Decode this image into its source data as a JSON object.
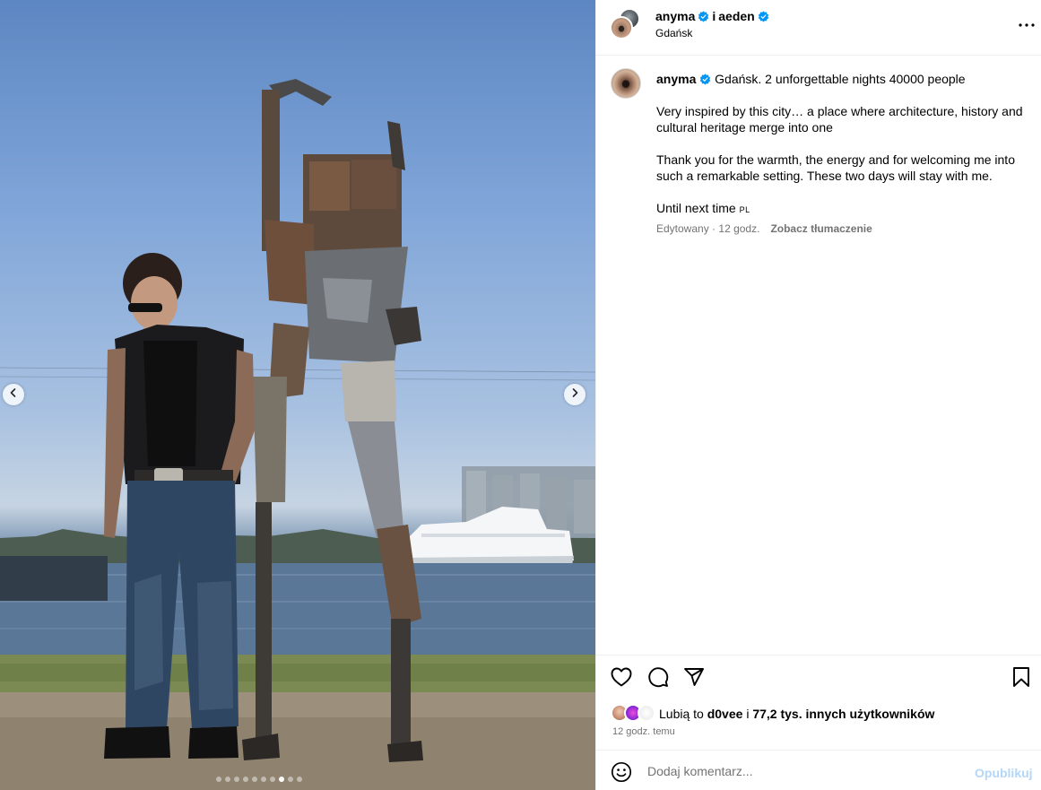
{
  "post": {
    "media": {
      "slide_count": 10,
      "active_slide": 8,
      "prev_icon": "chevron-left-icon",
      "next_icon": "chevron-right-icon"
    },
    "header": {
      "author": "anyma",
      "separator": "i",
      "coauthor": "aeden",
      "location": "Gdańsk",
      "verified_color": "#0095f6",
      "more_icon": "more-horizontal-icon"
    },
    "caption": {
      "username": "anyma",
      "first_line": "Gdańsk. 2 unforgettable nights 40000 people",
      "paragraph_2": "Very inspired by this city… a place where architecture, history and cultural heritage merge into one",
      "paragraph_3": "Thank you for the warmth, the energy and for welcoming me into such a remarkable setting. These two days will stay with me.",
      "paragraph_4": "Until next time",
      "flag_tag": "PL",
      "edited": "Edytowany",
      "dot": "·",
      "time": "12 godz.",
      "translate": "Zobacz tłumaczenie"
    },
    "actions": {
      "like_icon": "heart-icon",
      "comment_icon": "comment-icon",
      "share_icon": "send-icon",
      "save_icon": "bookmark-icon"
    },
    "likes": {
      "prefix": "Lubią to",
      "user": "d0vee",
      "joiner": "i",
      "others": "77,2 tys. innych użytkowników"
    },
    "timestamp": "12 godz. temu",
    "comment": {
      "placeholder": "Dodaj komentarz...",
      "publish": "Opublikuj",
      "emoji_icon": "emoji-smile-icon",
      "publish_color": "#b3d6f9"
    }
  }
}
